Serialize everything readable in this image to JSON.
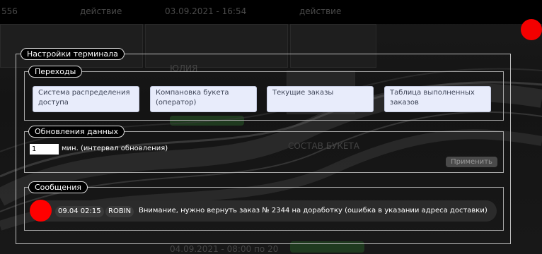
{
  "background": {
    "header": {
      "col1": "556",
      "col2": "действие",
      "col3": "03.09.2021 - 16:54",
      "col4": "действие"
    },
    "client_name": "ЮЛИЯ",
    "composition_label": "СОСТАВ БУКЕТА",
    "bottom_date": "04.09.2021 - 08:00 по 20"
  },
  "modal": {
    "title": "Настройки терминала",
    "navigation": {
      "legend": "Переходы",
      "buttons": [
        {
          "line1": "Система распределения",
          "line2": "доступа"
        },
        {
          "line1": "Компановка букета",
          "line2": "(оператор)"
        },
        {
          "line1": "Текущие заказы",
          "line2": ""
        },
        {
          "line1": "Таблица выполненных",
          "line2": "заказов"
        }
      ]
    },
    "updates": {
      "legend": "Обновления данных",
      "interval_value": "1",
      "interval_label": "мин. (интервал обновления)",
      "apply_label": "Применить"
    },
    "messages": {
      "legend": "Сообщения",
      "items": [
        {
          "time": "09.04 02:15",
          "author": "ROBIN",
          "text": "Внимание, нужно вернуть заказ № 2344 на доработку (ошибка в указании адреса доставки)",
          "status_color": "#ff0000"
        }
      ]
    }
  },
  "colors": {
    "alert": "#f30000",
    "button_bg": "#e8ecfb"
  }
}
